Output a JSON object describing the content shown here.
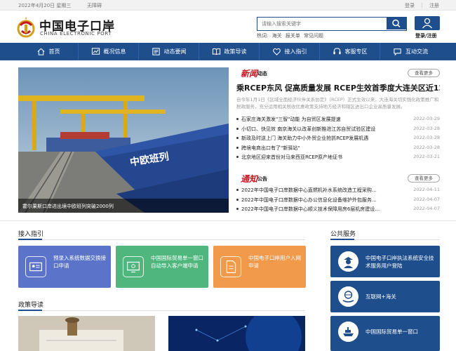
{
  "topbar": {
    "date": "2022年4月20日 星期三",
    "accessibility": "无障碍",
    "login": "登录",
    "separator": "|",
    "register": "注册"
  },
  "logo": {
    "cn": "中国电子口岸",
    "en": "CHINA ELECTRONIC PORT"
  },
  "search": {
    "placeholder": "请输入搜索关键字",
    "hot_label": "热词:",
    "hot_terms": [
      "海关",
      "报关单",
      "常见问题"
    ]
  },
  "user": {
    "login": "登录",
    "separator": "/",
    "register": "注册"
  },
  "nav": {
    "items": [
      {
        "label": "首页",
        "icon": "home-icon"
      },
      {
        "label": "概况信息",
        "icon": "chart-icon"
      },
      {
        "label": "动态要闻",
        "icon": "news-icon"
      },
      {
        "label": "政策导读",
        "icon": "book-icon"
      },
      {
        "label": "接入指引",
        "icon": "heart-hand-icon"
      },
      {
        "label": "客服专区",
        "icon": "headset-icon"
      },
      {
        "label": "互动交流",
        "icon": "chat-icon"
      }
    ]
  },
  "hero": {
    "caption": "霍尔果斯口岸进出境中欧班列突破2000列"
  },
  "news": {
    "title_big": "新闻",
    "title_small": "动态",
    "more": "查看更多",
    "headline": "乘RCEP东风 促高质量发展 RCEP生效首季度大连关区近12亿元…",
    "summary": "自今年1月1日《区域全面经济伙伴关系协定》（RCEP）正式生效以来，大连海关切实强化政策推广和税政服务，充分运用相关税收优惠政策支持地方经济和辖区进出口企业高质量发展。",
    "items": [
      {
        "text": "石家庄海关激发\"三智\"动能 为自贸区发展提速",
        "date": "2022-03-29"
      },
      {
        "text": "小切口、快见效 南京海关以改革创新推进江苏自贸试验区建设",
        "date": "2022-03-28"
      },
      {
        "text": "新政及时送上门 海关助力中小外贸企业抢抓RCEP发展机遇",
        "date": "2022-03-28"
      },
      {
        "text": "跨境电商出口有了\"新驿站\"",
        "date": "2022-03-28"
      },
      {
        "text": "北京地区迎来首份对马来西亚RCEP原产地证书",
        "date": "2022-03-21"
      }
    ]
  },
  "notice": {
    "title_big": "通知",
    "title_small": "公告",
    "more": "查看更多",
    "items": [
      {
        "text": "2022年中国电子口岸数据中心直燃机补水系统改造工程采购…",
        "date": "2022-04-11"
      },
      {
        "text": "2022年中国电子口岸数据中心办公信息化设备维护外包服务…",
        "date": "2022-04-07"
      },
      {
        "text": "2022年中国电子口岸数据中心顺义技术保障用房6层机房建设…",
        "date": "2022-04-07"
      }
    ]
  },
  "access": {
    "title": "接入指引",
    "cards": [
      {
        "label": "预录入系统数据交换接口申请",
        "icon": "id-card-icon",
        "color": "#5b73c8"
      },
      {
        "label": "中国国际贸易单一窗口自动导入客户端申请",
        "icon": "monitor-icon",
        "color": "#4fb77d"
      },
      {
        "label": "中国电子口岸用户入网申请",
        "icon": "document-icon",
        "color": "#f19a4b"
      }
    ]
  },
  "public": {
    "title": "公共服务",
    "items": [
      {
        "label": "中国电子口岸执法系统安全技术服务用户登陆",
        "icon": "officer-icon"
      },
      {
        "label": "互联网+海关",
        "icon": "globe-hand-icon"
      },
      {
        "label": "中国国际贸易单一窗口",
        "icon": "ship-icon"
      }
    ]
  },
  "policy": {
    "title": "政策导读"
  },
  "colors": {
    "primary": "#1e4e8c",
    "accent_red": "#c9151e"
  }
}
